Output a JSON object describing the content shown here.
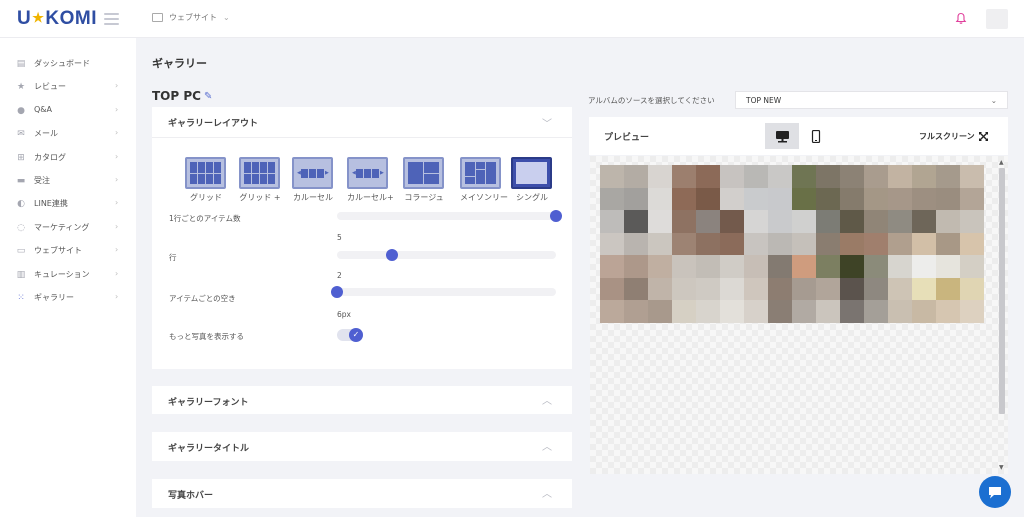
{
  "brand": {
    "logo_left": "U",
    "logo_star": "★",
    "logo_right": "KOMI"
  },
  "topbar": {
    "site_label": "ウェブサイト",
    "site_caret": "⌄"
  },
  "sidebar": {
    "items": [
      {
        "label": "ダッシュボード",
        "icon": "dashboard-icon",
        "chevron": false
      },
      {
        "label": "レビュー",
        "icon": "star-icon",
        "chevron": true
      },
      {
        "label": "Q&A",
        "icon": "chat-icon",
        "chevron": true
      },
      {
        "label": "メール",
        "icon": "mail-icon",
        "chevron": true
      },
      {
        "label": "カタログ",
        "icon": "cart-icon",
        "chevron": true
      },
      {
        "label": "受注",
        "icon": "truck-icon",
        "chevron": true
      },
      {
        "label": "LINE連携",
        "icon": "line-icon",
        "chevron": true
      },
      {
        "label": "マーケティング",
        "icon": "marketing-icon",
        "chevron": true
      },
      {
        "label": "ウェブサイト",
        "icon": "window-icon",
        "chevron": true
      },
      {
        "label": "キュレーション",
        "icon": "curation-icon",
        "chevron": true
      },
      {
        "label": "ギャラリー",
        "icon": "gallery-icon",
        "chevron": true
      }
    ]
  },
  "main": {
    "page_title": "ギャラリー",
    "section_title": "TOP PC",
    "layout_card": {
      "header": "ギャラリーレイアウト",
      "options": [
        {
          "label": "グリッド"
        },
        {
          "label": "グリッド +"
        },
        {
          "label": "カルーセル"
        },
        {
          "label": "カルーセル+"
        },
        {
          "label": "コラージュ"
        },
        {
          "label": "メイソンリー"
        },
        {
          "label": "シングル"
        }
      ],
      "selected": "シングル",
      "settings": {
        "items_per_row_label": "1行ごとのアイテム数",
        "items_per_row_value": "5",
        "items_per_row_level": 1.0,
        "rows_label": "行",
        "rows_value": "2",
        "rows_level": 0.25,
        "gap_label": "アイテムごとの空き",
        "gap_value": "6px",
        "gap_level": 0.0,
        "show_more_label": "もっと写真を表示する",
        "show_more_on": true
      }
    },
    "font_card": {
      "header": "ギャラリーフォント"
    },
    "title_card": {
      "header": "ギャラリータイトル"
    },
    "hover_card": {
      "header": "写真ホバー"
    }
  },
  "right": {
    "source_label": "アルバムのソースを選択してください",
    "source_value": "TOP NEW",
    "preview_label": "プレビュー",
    "fullscreen_label": "フルスクリーン",
    "device_selected": "desktop"
  },
  "colors": {
    "accent": "#4f5fd1",
    "brand": "#2f4ea3",
    "chat": "#1b6fd1",
    "bell": "#e0409c"
  }
}
